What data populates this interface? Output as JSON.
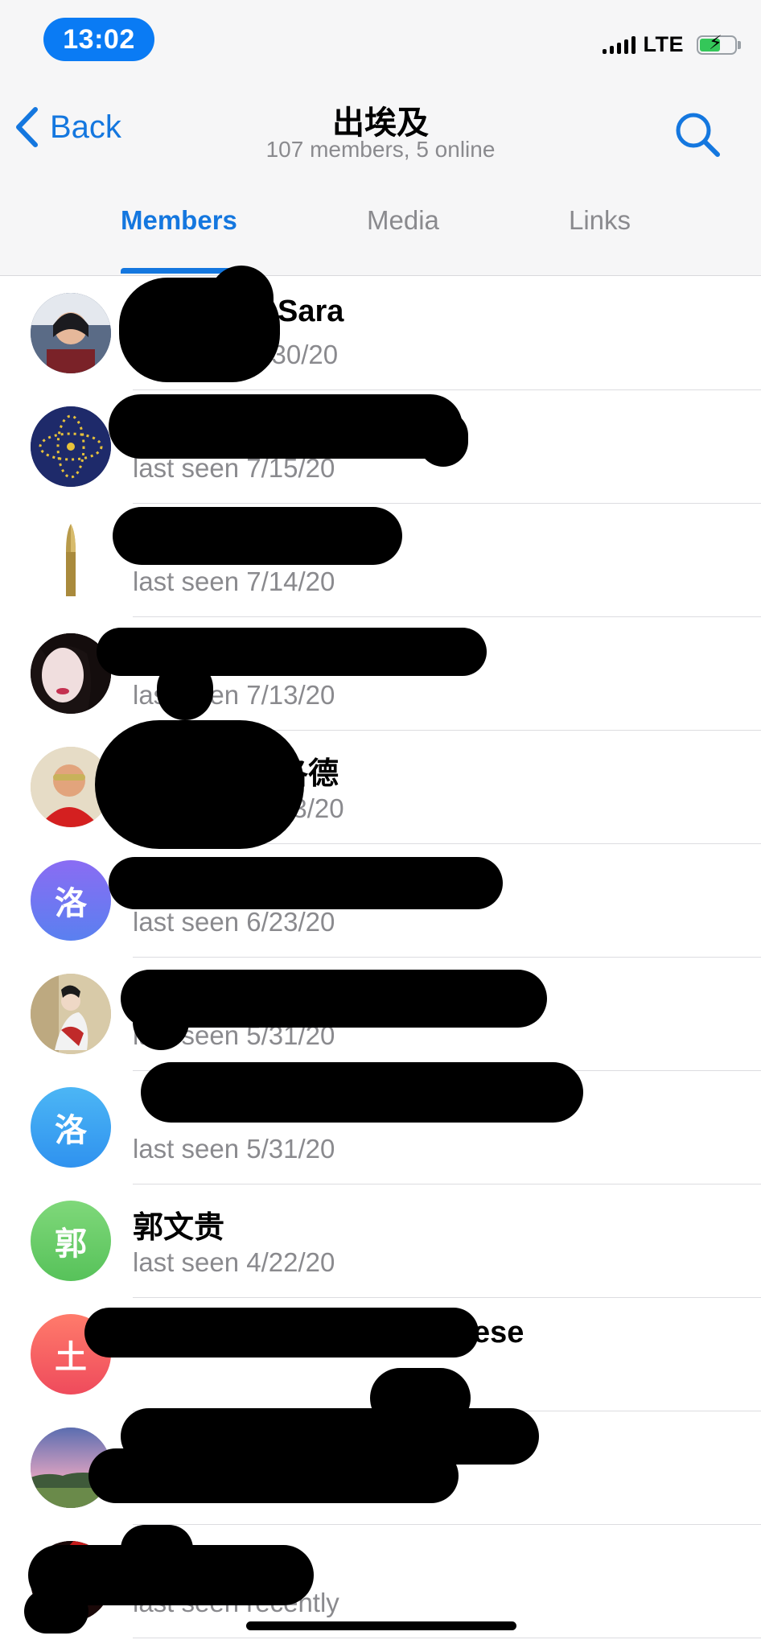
{
  "status_bar": {
    "time": "13:02",
    "network": "LTE"
  },
  "nav": {
    "back_label": "Back",
    "title": "出埃及",
    "subtitle": "107 members, 5 online"
  },
  "tabs": [
    {
      "label": "Members",
      "active": true
    },
    {
      "label": "Media",
      "active": false
    },
    {
      "label": "Links",
      "active": false
    }
  ],
  "colors": {
    "accent": "#1477df",
    "time_pill": "#0a7bf4",
    "secondary_text": "#8a8a8e"
  },
  "members": [
    {
      "name": "Sara",
      "status": "7/30/20",
      "avatar": "photo-woman"
    },
    {
      "name": "",
      "status": "last seen 7/15/20",
      "avatar": "emblem-dots"
    },
    {
      "name": "",
      "status": "last seen 7/14/20",
      "avatar": "bullet"
    },
    {
      "name": "",
      "status": "last seen 7/13/20",
      "avatar": "photo-face"
    },
    {
      "name": "洛德",
      "status": "13/20",
      "avatar": "photo-man-red"
    },
    {
      "name": "",
      "status": "last seen 6/23/20",
      "avatar_letter": "洛",
      "avatar_color": "#6b74f0"
    },
    {
      "name": "",
      "status": "last seen 5/31/20",
      "avatar": "photo-painting"
    },
    {
      "name": "",
      "status": "last seen 5/31/20",
      "avatar_letter": "洛",
      "avatar_color": "#3aa4f0"
    },
    {
      "name": "郭文贵",
      "status": "last seen 4/22/20",
      "avatar_letter": "郭",
      "avatar_color": "#6fcf6a"
    },
    {
      "name": "ese",
      "status": "",
      "avatar_letter": "土",
      "avatar_color": "#f05a5a"
    },
    {
      "name": "",
      "status": "",
      "avatar": "photo-landscape"
    },
    {
      "name": "",
      "status": "last seen recently",
      "avatar": "photo-red"
    }
  ]
}
